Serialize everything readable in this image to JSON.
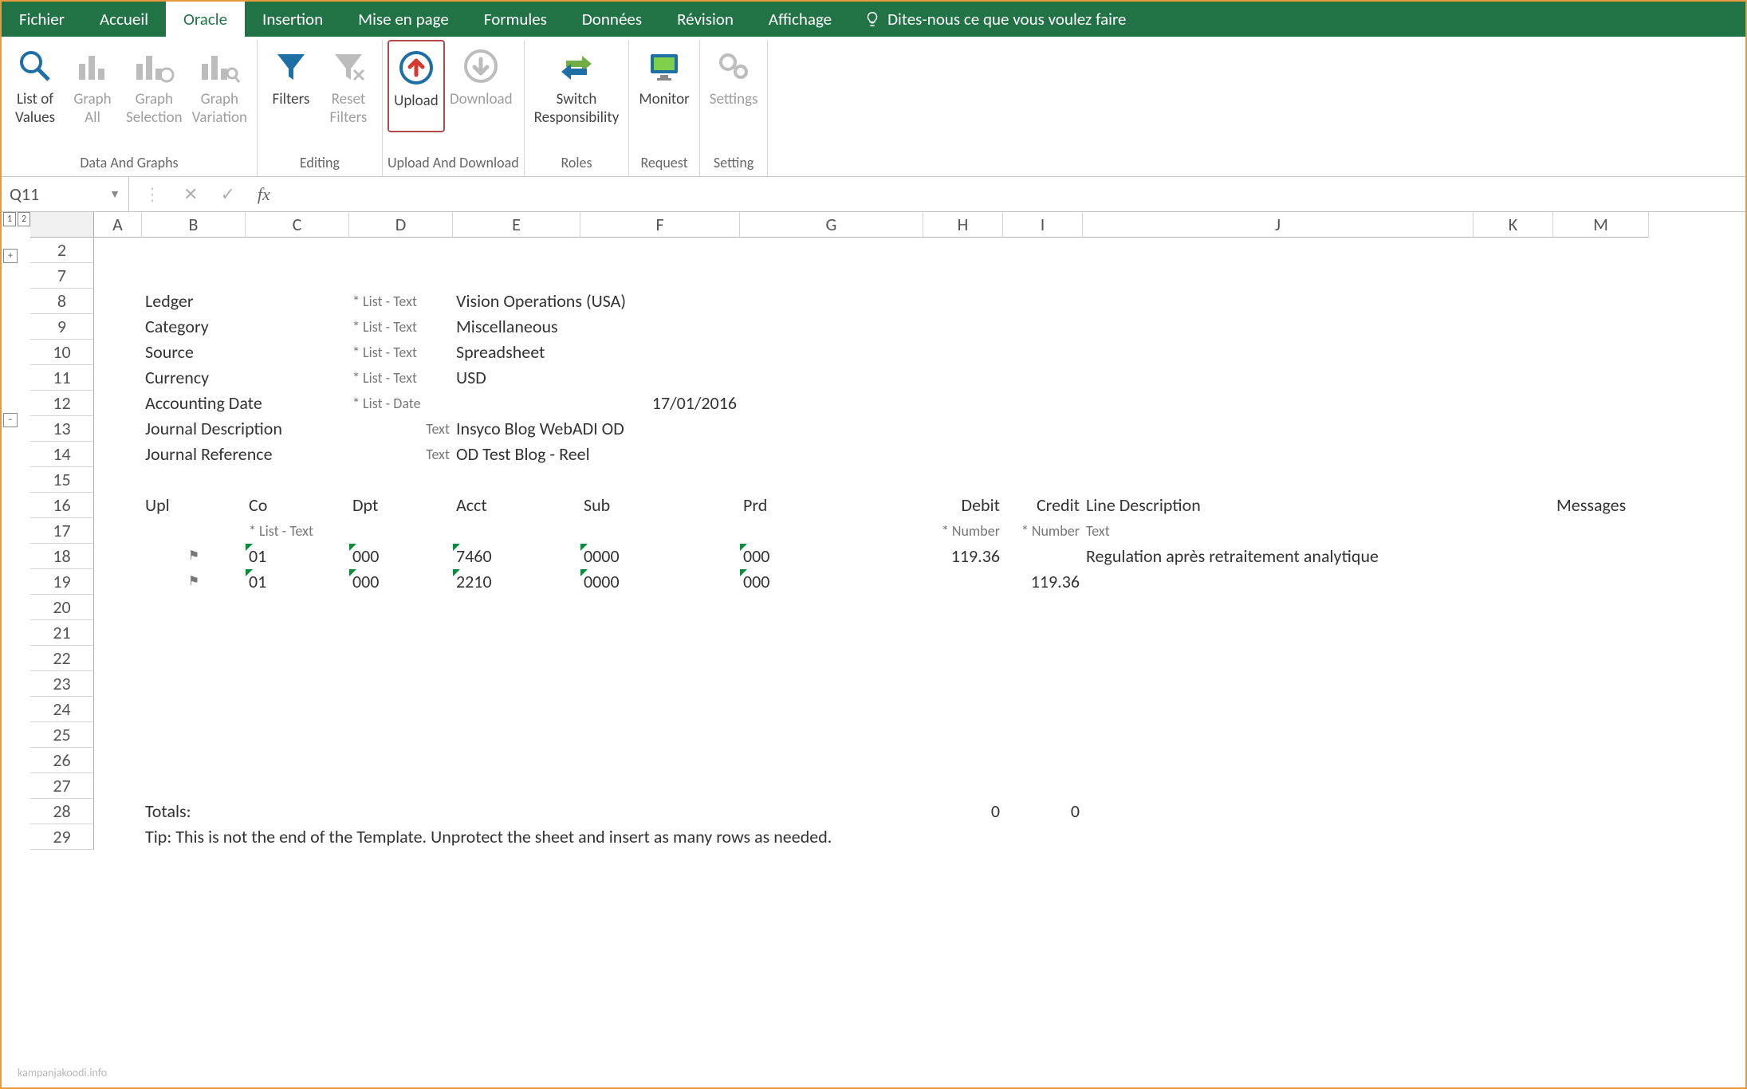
{
  "tabs": {
    "file": "Fichier",
    "home": "Accueil",
    "oracle": "Oracle",
    "insert": "Insertion",
    "layout": "Mise en page",
    "formulas": "Formules",
    "data": "Données",
    "review": "Révision",
    "view": "Affichage",
    "tellme": "Dites-nous ce que vous voulez faire"
  },
  "ribbon": {
    "listofvalues": "List of\nValues",
    "graph_all": "Graph\nAll",
    "graph_selection": "Graph\nSelection",
    "graph_variation": "Graph\nVariation",
    "filters": "Filters",
    "reset_filters": "Reset\nFilters",
    "upload": "Upload",
    "download": "Download",
    "switch_resp": "Switch\nResponsibility",
    "monitor": "Monitor",
    "settings": "Settings",
    "grp_data_graphs": "Data And Graphs",
    "grp_editing": "Editing",
    "grp_upload_download": "Upload And Download",
    "grp_roles": "Roles",
    "grp_request": "Request",
    "grp_setting": "Setting"
  },
  "formula": {
    "cellref": "Q11",
    "fx": "fx"
  },
  "cols": {
    "A": "A",
    "B": "B",
    "C": "C",
    "D": "D",
    "E": "E",
    "F": "F",
    "G": "G",
    "H": "H",
    "I": "I",
    "J": "J",
    "K": "K",
    "M": "M"
  },
  "rows": [
    "2",
    "7",
    "8",
    "9",
    "10",
    "11",
    "12",
    "13",
    "14",
    "15",
    "16",
    "17",
    "18",
    "19",
    "20",
    "21",
    "22",
    "23",
    "24",
    "25",
    "26",
    "27",
    "28",
    "29"
  ],
  "form": {
    "ledger_l": "Ledger",
    "ledger_h": "* List - Text",
    "ledger_v": "Vision Operations (USA)",
    "category_l": "Category",
    "category_h": "* List - Text",
    "category_v": "Miscellaneous",
    "source_l": "Source",
    "source_h": "* List - Text",
    "source_v": "Spreadsheet",
    "currency_l": "Currency",
    "currency_h": "* List - Text",
    "currency_v": "USD",
    "acctdate_l": "Accounting Date",
    "acctdate_h": "* List - Date",
    "acctdate_v": "17/01/2016",
    "jdesc_l": "Journal Description",
    "jdesc_h": "Text",
    "jdesc_v": "Insyco Blog WebADI OD",
    "jref_l": "Journal Reference",
    "jref_h": "Text",
    "jref_v": "OD Test Blog - Reel"
  },
  "hdr": {
    "upl": "Upl",
    "co": "Co",
    "dpt": "Dpt",
    "acct": "Acct",
    "sub": "Sub",
    "prd": "Prd",
    "debit": "Debit",
    "credit": "Credit",
    "linedesc": "Line Description",
    "messages": "Messages"
  },
  "hints": {
    "co": "* List - Text",
    "debit": "* Number",
    "credit": "* Number",
    "linedesc": "Text"
  },
  "lines": [
    {
      "flag": "⚑",
      "co": "01",
      "dpt": "000",
      "acct": "7460",
      "sub": "0000",
      "prd": "000",
      "debit": "119.36",
      "credit": "",
      "desc": "Regulation après retraitement analytique"
    },
    {
      "flag": "⚑",
      "co": "01",
      "dpt": "000",
      "acct": "2210",
      "sub": "0000",
      "prd": "000",
      "debit": "",
      "credit": "119.36",
      "desc": ""
    }
  ],
  "totals": {
    "label": "Totals:",
    "debit": "0",
    "credit": "0"
  },
  "tip": "Tip: This is not the end of the Template.  Unprotect the sheet and insert as many rows as needed.",
  "watermark": "kampanjakoodi.info"
}
